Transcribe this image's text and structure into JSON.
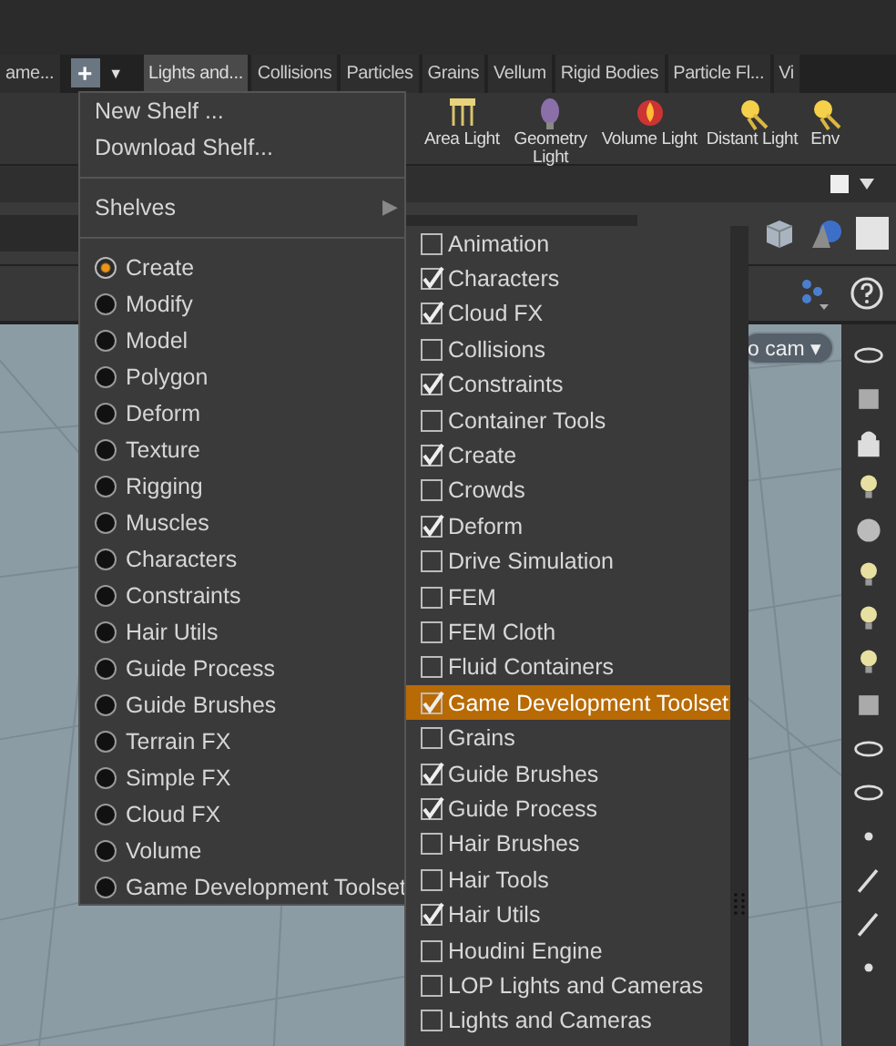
{
  "shelf_tabs": [
    {
      "label": "ame...",
      "selected": false
    },
    {
      "label": "Lights and...",
      "selected": true
    },
    {
      "label": "Collisions",
      "selected": false
    },
    {
      "label": "Particles",
      "selected": false
    },
    {
      "label": "Grains",
      "selected": false
    },
    {
      "label": "Vellum",
      "selected": false
    },
    {
      "label": "Rigid Bodies",
      "selected": false
    },
    {
      "label": "Particle Fl...",
      "selected": false
    },
    {
      "label": "Vi",
      "selected": false
    }
  ],
  "add_shelf_button": "+",
  "shelf_dropdown_button": "▼",
  "shelf_tools": [
    {
      "label": "Area Light"
    },
    {
      "label": "Geometry Light"
    },
    {
      "label": "Volume Light"
    },
    {
      "label": "Distant Light"
    },
    {
      "label": "Env"
    }
  ],
  "viewport": {
    "camera_button": "o cam ▾"
  },
  "shelf_menu": {
    "actions": [
      "New Shelf ...",
      "Download Shelf..."
    ],
    "submenu_label": "Shelves",
    "submenu_arrow": "▶",
    "shelf_sets": [
      {
        "label": "Create",
        "selected": true
      },
      {
        "label": "Modify",
        "selected": false
      },
      {
        "label": "Model",
        "selected": false
      },
      {
        "label": "Polygon",
        "selected": false
      },
      {
        "label": "Deform",
        "selected": false
      },
      {
        "label": "Texture",
        "selected": false
      },
      {
        "label": "Rigging",
        "selected": false
      },
      {
        "label": "Muscles",
        "selected": false
      },
      {
        "label": "Characters",
        "selected": false
      },
      {
        "label": "Constraints",
        "selected": false
      },
      {
        "label": "Hair Utils",
        "selected": false
      },
      {
        "label": "Guide Process",
        "selected": false
      },
      {
        "label": "Guide Brushes",
        "selected": false
      },
      {
        "label": "Terrain FX",
        "selected": false
      },
      {
        "label": "Simple FX",
        "selected": false
      },
      {
        "label": "Cloud FX",
        "selected": false
      },
      {
        "label": "Volume",
        "selected": false
      },
      {
        "label": "Game Development Toolset",
        "selected": false
      }
    ]
  },
  "shelves_submenu": {
    "items": [
      {
        "label": "Animation",
        "checked": false,
        "highlighted": false
      },
      {
        "label": "Characters",
        "checked": true,
        "highlighted": false
      },
      {
        "label": "Cloud FX",
        "checked": true,
        "highlighted": false
      },
      {
        "label": "Collisions",
        "checked": false,
        "highlighted": false
      },
      {
        "label": "Constraints",
        "checked": true,
        "highlighted": false
      },
      {
        "label": "Container Tools",
        "checked": false,
        "highlighted": false
      },
      {
        "label": "Create",
        "checked": true,
        "highlighted": false
      },
      {
        "label": "Crowds",
        "checked": false,
        "highlighted": false
      },
      {
        "label": "Deform",
        "checked": true,
        "highlighted": false
      },
      {
        "label": "Drive Simulation",
        "checked": false,
        "highlighted": false
      },
      {
        "label": "FEM",
        "checked": false,
        "highlighted": false
      },
      {
        "label": "FEM Cloth",
        "checked": false,
        "highlighted": false
      },
      {
        "label": "Fluid Containers",
        "checked": false,
        "highlighted": false
      },
      {
        "label": "Game Development Toolset",
        "checked": true,
        "highlighted": true
      },
      {
        "label": "Grains",
        "checked": false,
        "highlighted": false
      },
      {
        "label": "Guide Brushes",
        "checked": true,
        "highlighted": false
      },
      {
        "label": "Guide Process",
        "checked": true,
        "highlighted": false
      },
      {
        "label": "Hair Brushes",
        "checked": false,
        "highlighted": false
      },
      {
        "label": "Hair Tools",
        "checked": false,
        "highlighted": false
      },
      {
        "label": "Hair Utils",
        "checked": true,
        "highlighted": false
      },
      {
        "label": "Houdini Engine",
        "checked": false,
        "highlighted": false
      },
      {
        "label": "LOP Lights and Cameras",
        "checked": false,
        "highlighted": false
      },
      {
        "label": "Lights and Cameras",
        "checked": false,
        "highlighted": false
      }
    ]
  }
}
